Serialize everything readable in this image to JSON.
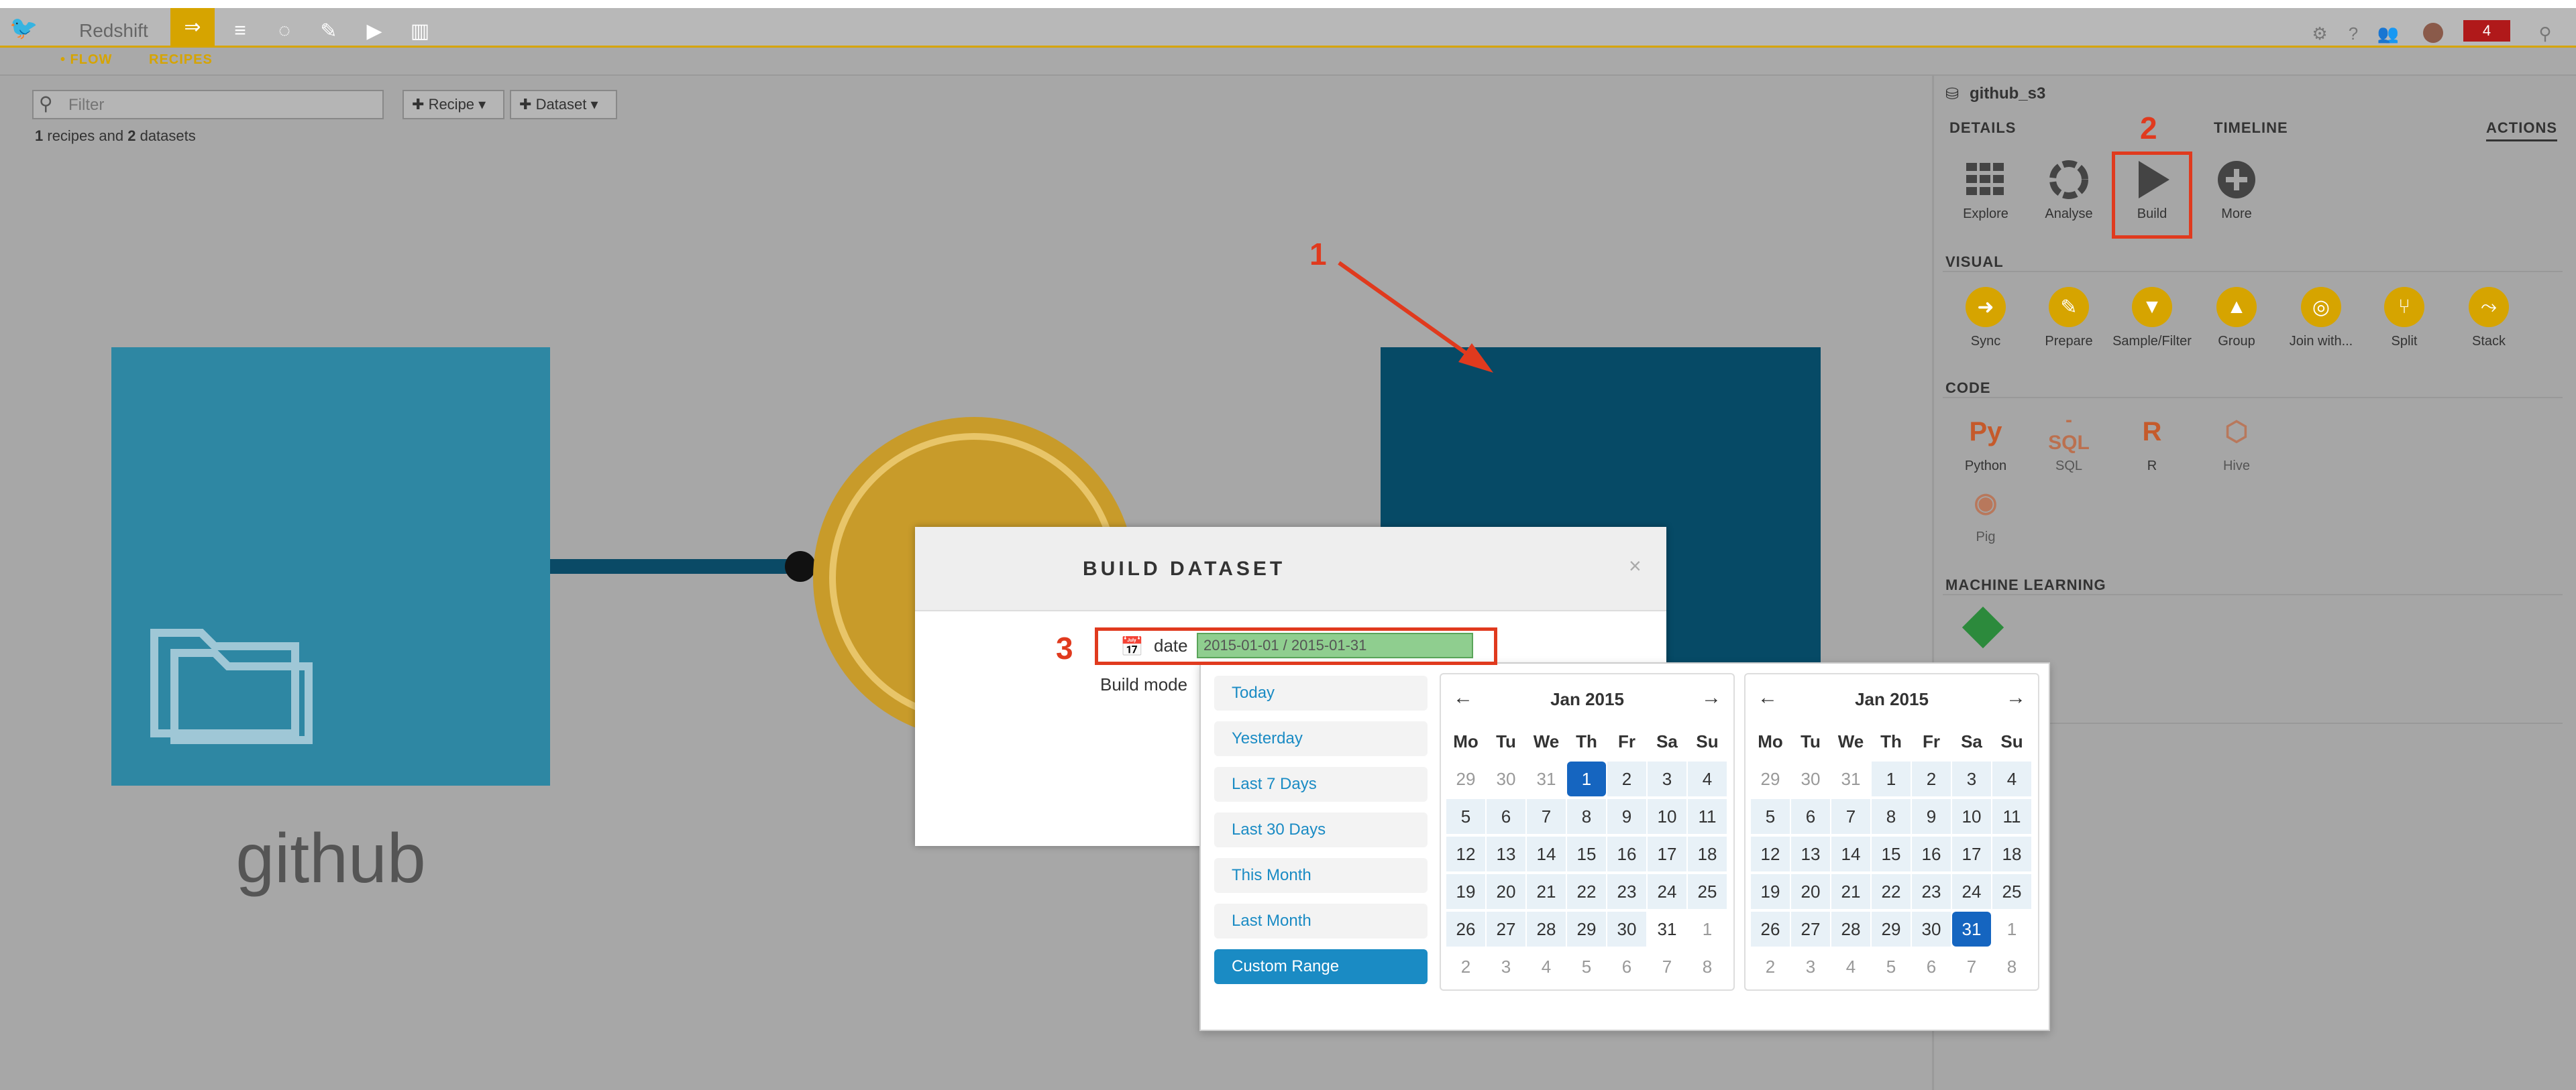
{
  "app": {
    "project_name": "Redshift",
    "subtabs": [
      "• FLOW",
      "RECIPES"
    ],
    "notification_count": "4"
  },
  "flow": {
    "filter_placeholder": "Filter",
    "recipe_button": "Recipe",
    "dataset_button": "Dataset",
    "summary": {
      "recipes": "1",
      "recipes_text": " recipes and ",
      "datasets": "2",
      "datasets_text": " datasets"
    },
    "source_dataset_label": "github"
  },
  "annotations": {
    "one": "1",
    "two": "2",
    "three": "3"
  },
  "right_panel": {
    "dataset_name": "github_s3",
    "tabs": {
      "details": "DETAILS",
      "timeline": "TIMELINE",
      "actions": "ACTIONS"
    },
    "actions": [
      {
        "label": "Explore",
        "icon": "grid-icon"
      },
      {
        "label": "Analyse",
        "icon": "analyse-icon"
      },
      {
        "label": "Build",
        "icon": "play-icon"
      },
      {
        "label": "More",
        "icon": "plus-circle-icon"
      }
    ],
    "visual_title": "VISUAL",
    "visual": [
      "Sync",
      "Prepare",
      "Sample/Filter",
      "Group",
      "Join with...",
      "Split",
      "Stack"
    ],
    "code_title": "CODE",
    "code": [
      {
        "label": "Python",
        "glyph": "Py"
      },
      {
        "label": "SQL",
        "glyph": "-SQL"
      },
      {
        "label": "R",
        "glyph": "R"
      },
      {
        "label": "Hive",
        "glyph": "⬡"
      },
      {
        "label": "Pig",
        "glyph": "◉"
      }
    ],
    "ml_title": "MACHINE LEARNING"
  },
  "modal": {
    "title": "BUILD DATASET",
    "close": "×",
    "date_label": "date",
    "date_value": "2015-01-01 / 2015-01-31",
    "build_mode_label": "Build mode"
  },
  "picker": {
    "ranges": [
      "Today",
      "Yesterday",
      "Last 7 Days",
      "Last 30 Days",
      "This Month",
      "Last Month",
      "Custom Range"
    ],
    "active_range": "Custom Range",
    "weekdays": [
      "Mo",
      "Tu",
      "We",
      "Th",
      "Fr",
      "Sa",
      "Su"
    ],
    "left": {
      "month": "Jan 2015",
      "prev": "←",
      "next": "→",
      "weeks": [
        [
          "29",
          "30",
          "31",
          "1",
          "2",
          "3",
          "4"
        ],
        [
          "5",
          "6",
          "7",
          "8",
          "9",
          "10",
          "11"
        ],
        [
          "12",
          "13",
          "14",
          "15",
          "16",
          "17",
          "18"
        ],
        [
          "19",
          "20",
          "21",
          "22",
          "23",
          "24",
          "25"
        ],
        [
          "26",
          "27",
          "28",
          "29",
          "30",
          "31",
          "1"
        ],
        [
          "2",
          "3",
          "4",
          "5",
          "6",
          "7",
          "8"
        ]
      ],
      "selected": "1"
    },
    "right": {
      "month": "Jan 2015",
      "prev": "←",
      "next": "→",
      "weeks": [
        [
          "29",
          "30",
          "31",
          "1",
          "2",
          "3",
          "4"
        ],
        [
          "5",
          "6",
          "7",
          "8",
          "9",
          "10",
          "11"
        ],
        [
          "12",
          "13",
          "14",
          "15",
          "16",
          "17",
          "18"
        ],
        [
          "19",
          "20",
          "21",
          "22",
          "23",
          "24",
          "25"
        ],
        [
          "26",
          "27",
          "28",
          "29",
          "30",
          "31",
          "1"
        ],
        [
          "2",
          "3",
          "4",
          "5",
          "6",
          "7",
          "8"
        ]
      ],
      "selected": "31"
    }
  },
  "colors": {
    "accent": "#d6a400",
    "annotation": "#e03a1e",
    "selected_day": "#1565c0",
    "link": "#1a8bc4"
  }
}
